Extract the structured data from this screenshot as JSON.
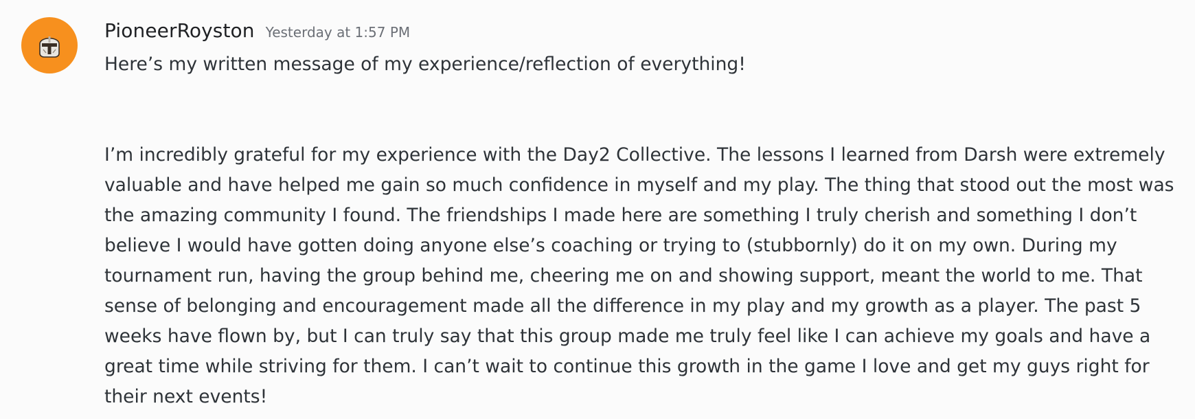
{
  "message": {
    "username": "PioneerRoyston",
    "timestamp": "Yesterday at 1:57 PM",
    "avatar_icon": "mandalorian-helmet-icon",
    "avatar_color": "#f7901e",
    "intro": "Here’s my written message of my experience/reflection of everything!",
    "body": "I’m incredibly grateful for my experience with the Day2 Collective. The lessons I learned from Darsh were extremely valuable and have helped me gain so much confidence in myself and my play. The thing that stood out the most was the amazing community I found. The friendships I made here are something I truly cherish and something I don’t believe I would have gotten doing anyone else’s coaching or trying to (stubbornly) do it on my own. During my tournament run, having the group behind me, cheering me on and showing support, meant the world to me. That sense of belonging and encouragement made all the difference in my play and my growth as a player. The past 5 weeks have flown by, but I can truly say that this group made me truly feel like I can achieve my goals and have a great time while striving for them. I can’t wait to continue this growth in the game I love and get my guys right for their next events!"
  }
}
